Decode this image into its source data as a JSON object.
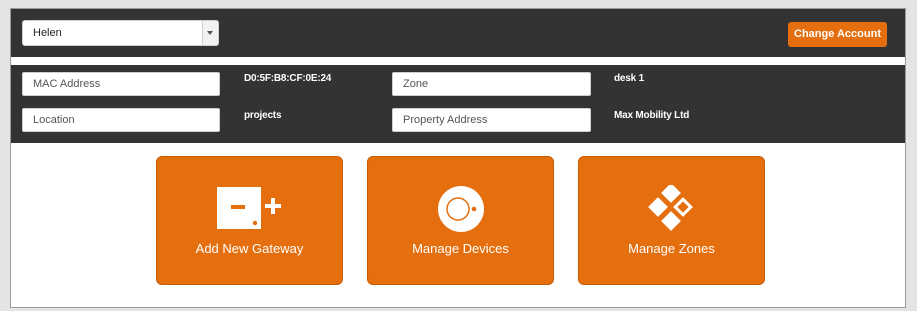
{
  "account": {
    "selected": "Helen"
  },
  "header": {
    "change_account_label": "Change Account"
  },
  "info": {
    "mac_placeholder": "MAC Address",
    "mac_value": "D0:5F:B8:CF:0E:24",
    "location_placeholder": "Location",
    "location_value": "projects",
    "zone_placeholder": "Zone",
    "zone_value": "desk 1",
    "property_placeholder": "Property Address",
    "property_value": "Max Mobility Ltd"
  },
  "tiles": [
    {
      "label": "Add New Gateway",
      "icon": "gateway-plus-icon"
    },
    {
      "label": "Manage Devices",
      "icon": "device-icon"
    },
    {
      "label": "Manage Zones",
      "icon": "zones-icon"
    }
  ],
  "colors": {
    "accent": "#e56e0e",
    "bar": "#333333"
  }
}
